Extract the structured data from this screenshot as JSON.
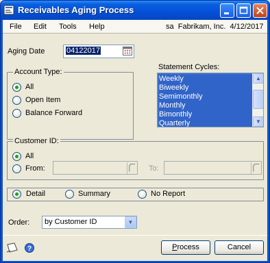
{
  "window": {
    "title": "Receivables Aging Process"
  },
  "menu": {
    "file": "File",
    "edit": "Edit",
    "tools": "Tools",
    "help": "Help",
    "context": "sa  Fabrikam, Inc.  4/12/2017"
  },
  "aging_date": {
    "label": "Aging Date",
    "value": "04122017"
  },
  "account_type": {
    "title": "Account Type:",
    "options": [
      "All",
      "Open Item",
      "Balance Forward"
    ],
    "selected": "All"
  },
  "statement_cycles": {
    "label": "Statement Cycles:",
    "items": [
      "Weekly",
      "Biweekly",
      "Semimonthly",
      "Monthly",
      "Bimonthly",
      "Quarterly"
    ]
  },
  "customer_id": {
    "title": "Customer ID:",
    "all": "All",
    "from": "From:",
    "to": "To:",
    "from_value": "",
    "to_value": ""
  },
  "report": {
    "options": [
      "Detail",
      "Summary",
      "No Report"
    ],
    "selected": "Detail"
  },
  "order": {
    "label": "Order:",
    "value": "by Customer ID"
  },
  "buttons": {
    "process": "Process",
    "process_mnemonic": "P",
    "process_rest": "rocess",
    "cancel": "Cancel"
  }
}
